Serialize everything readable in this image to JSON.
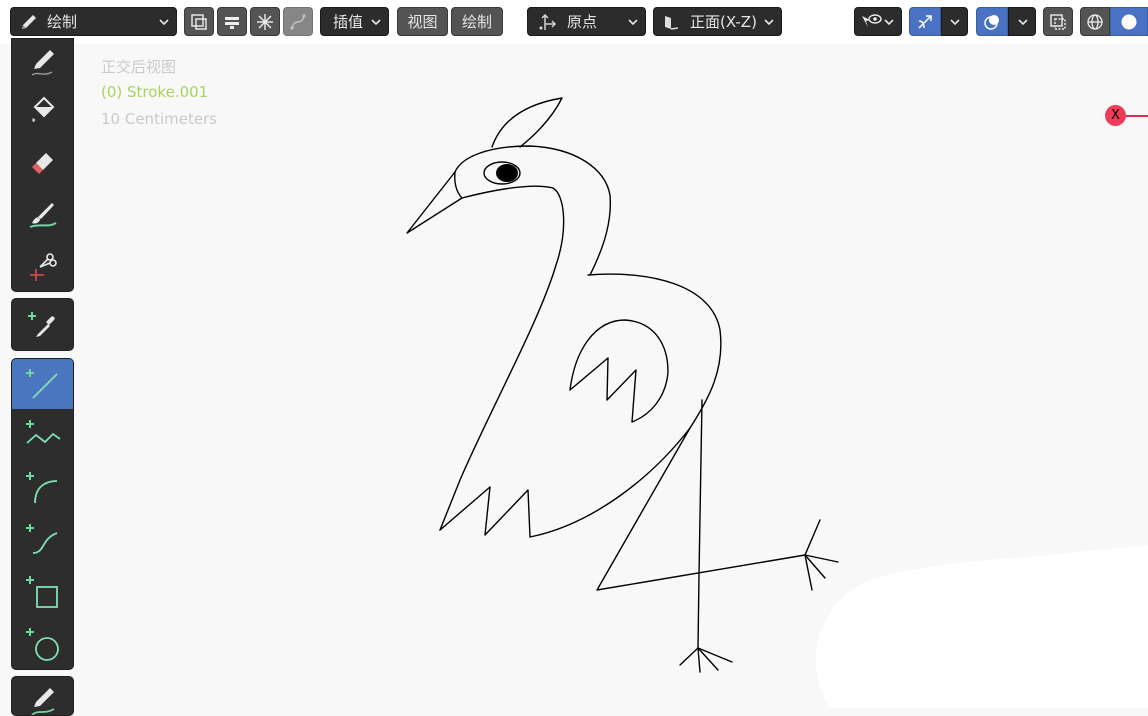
{
  "header": {
    "mode_label": "绘制",
    "interpolate_label": "插值",
    "view_label": "视图",
    "draw_label": "绘制",
    "origin_label": "原点",
    "plane_label": "正面(X-Z)"
  },
  "overlay": {
    "view_name": "正交后视图",
    "object_name": "(0) Stroke.001",
    "scale_text": "10 Centimeters"
  },
  "axis": {
    "x_label": "X"
  },
  "toolbar": {
    "tools": [
      "draw",
      "fill",
      "erase",
      "tint",
      "cutter",
      "eyedropper",
      "line",
      "polyline",
      "arc",
      "curve",
      "box",
      "circle",
      "annotate"
    ],
    "active_tool": "line"
  },
  "colors": {
    "accent": "#4a76c0",
    "object_text": "#a6d35a",
    "axis_x": "#f03a5a",
    "tool_green": "#6fd6a0"
  }
}
